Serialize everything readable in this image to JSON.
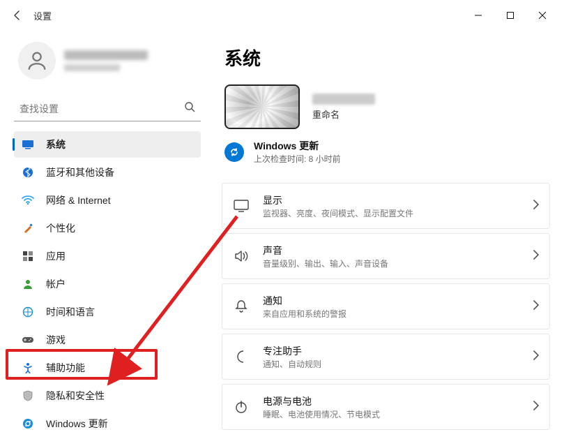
{
  "titlebar": {
    "title": "设置"
  },
  "search": {
    "placeholder": "查找设置"
  },
  "nav": {
    "items": [
      {
        "label": "系统"
      },
      {
        "label": "蓝牙和其他设备"
      },
      {
        "label": "网络 & Internet"
      },
      {
        "label": "个性化"
      },
      {
        "label": "应用"
      },
      {
        "label": "帐户"
      },
      {
        "label": "时间和语言"
      },
      {
        "label": "游戏"
      },
      {
        "label": "辅助功能"
      },
      {
        "label": "隐私和安全性"
      },
      {
        "label": "Windows 更新"
      }
    ]
  },
  "page": {
    "title": "系统",
    "rename": "重命名",
    "update_title": "Windows 更新",
    "update_sub": "上次检查时间: 8 小时前"
  },
  "cards": [
    {
      "title": "显示",
      "sub": "监视器、亮度、夜间模式、显示配置文件"
    },
    {
      "title": "声音",
      "sub": "音量级别、输出、输入、声音设备"
    },
    {
      "title": "通知",
      "sub": "来自应用和系统的警报"
    },
    {
      "title": "专注助手",
      "sub": "通知、自动规则"
    },
    {
      "title": "电源与电池",
      "sub": "睡眠、电池使用情况、节电模式"
    }
  ]
}
